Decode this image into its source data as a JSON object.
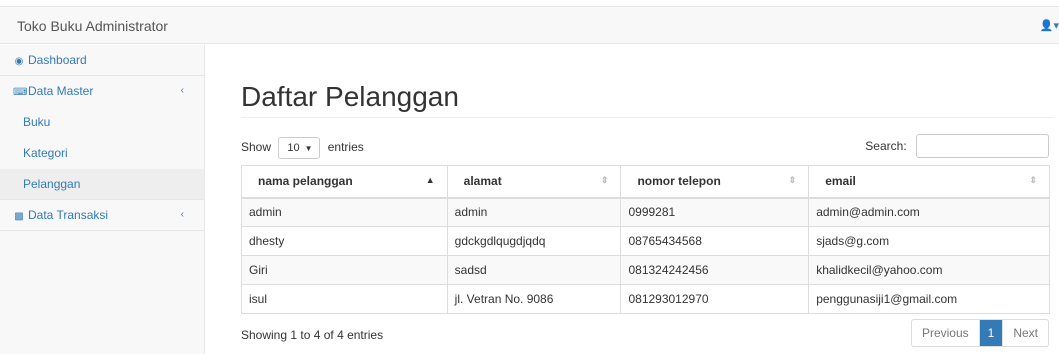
{
  "header": {
    "brand": "Toko Buku Administrator",
    "user_icon": "user-icon",
    "user_caret": "▾"
  },
  "sidebar": {
    "items": [
      {
        "icon": "dashboard-icon",
        "label": "Dashboard"
      },
      {
        "icon": "keyboard-icon",
        "label": "Data Master",
        "chevron": "‹"
      },
      {
        "label": "Buku"
      },
      {
        "label": "Kategori"
      },
      {
        "label": "Pelanggan",
        "active": true
      },
      {
        "icon": "bar-chart-icon",
        "label": "Data Transaksi",
        "chevron": "‹"
      }
    ]
  },
  "main": {
    "title": "Daftar Pelanggan",
    "length": {
      "show": "Show",
      "value": "10",
      "entries": "entries"
    },
    "search": {
      "label": "Search:",
      "value": ""
    },
    "table": {
      "columns": [
        "nama pelanggan",
        "alamat",
        "nomor telepon",
        "email"
      ],
      "rows": [
        [
          "admin",
          "admin",
          "0999281",
          "admin@admin.com"
        ],
        [
          "dhesty",
          "gdckgdlqugdjqdq",
          "08765434568",
          "sjads@g.com"
        ],
        [
          "Giri",
          "sadsd",
          "081324242456",
          "khalidkecil@yahoo.com"
        ],
        [
          "isul",
          "jl. Vetran No. 9086",
          "081293012970",
          "penggunasiji1@gmail.com"
        ]
      ]
    },
    "info": "Showing 1 to 4 of 4 entries",
    "pagination": {
      "previous": "Previous",
      "current": "1",
      "next": "Next"
    }
  },
  "colors": {
    "link": "#337ab7",
    "active_page": "#337ab7",
    "sidebar_bg": "#f8f8f8"
  }
}
